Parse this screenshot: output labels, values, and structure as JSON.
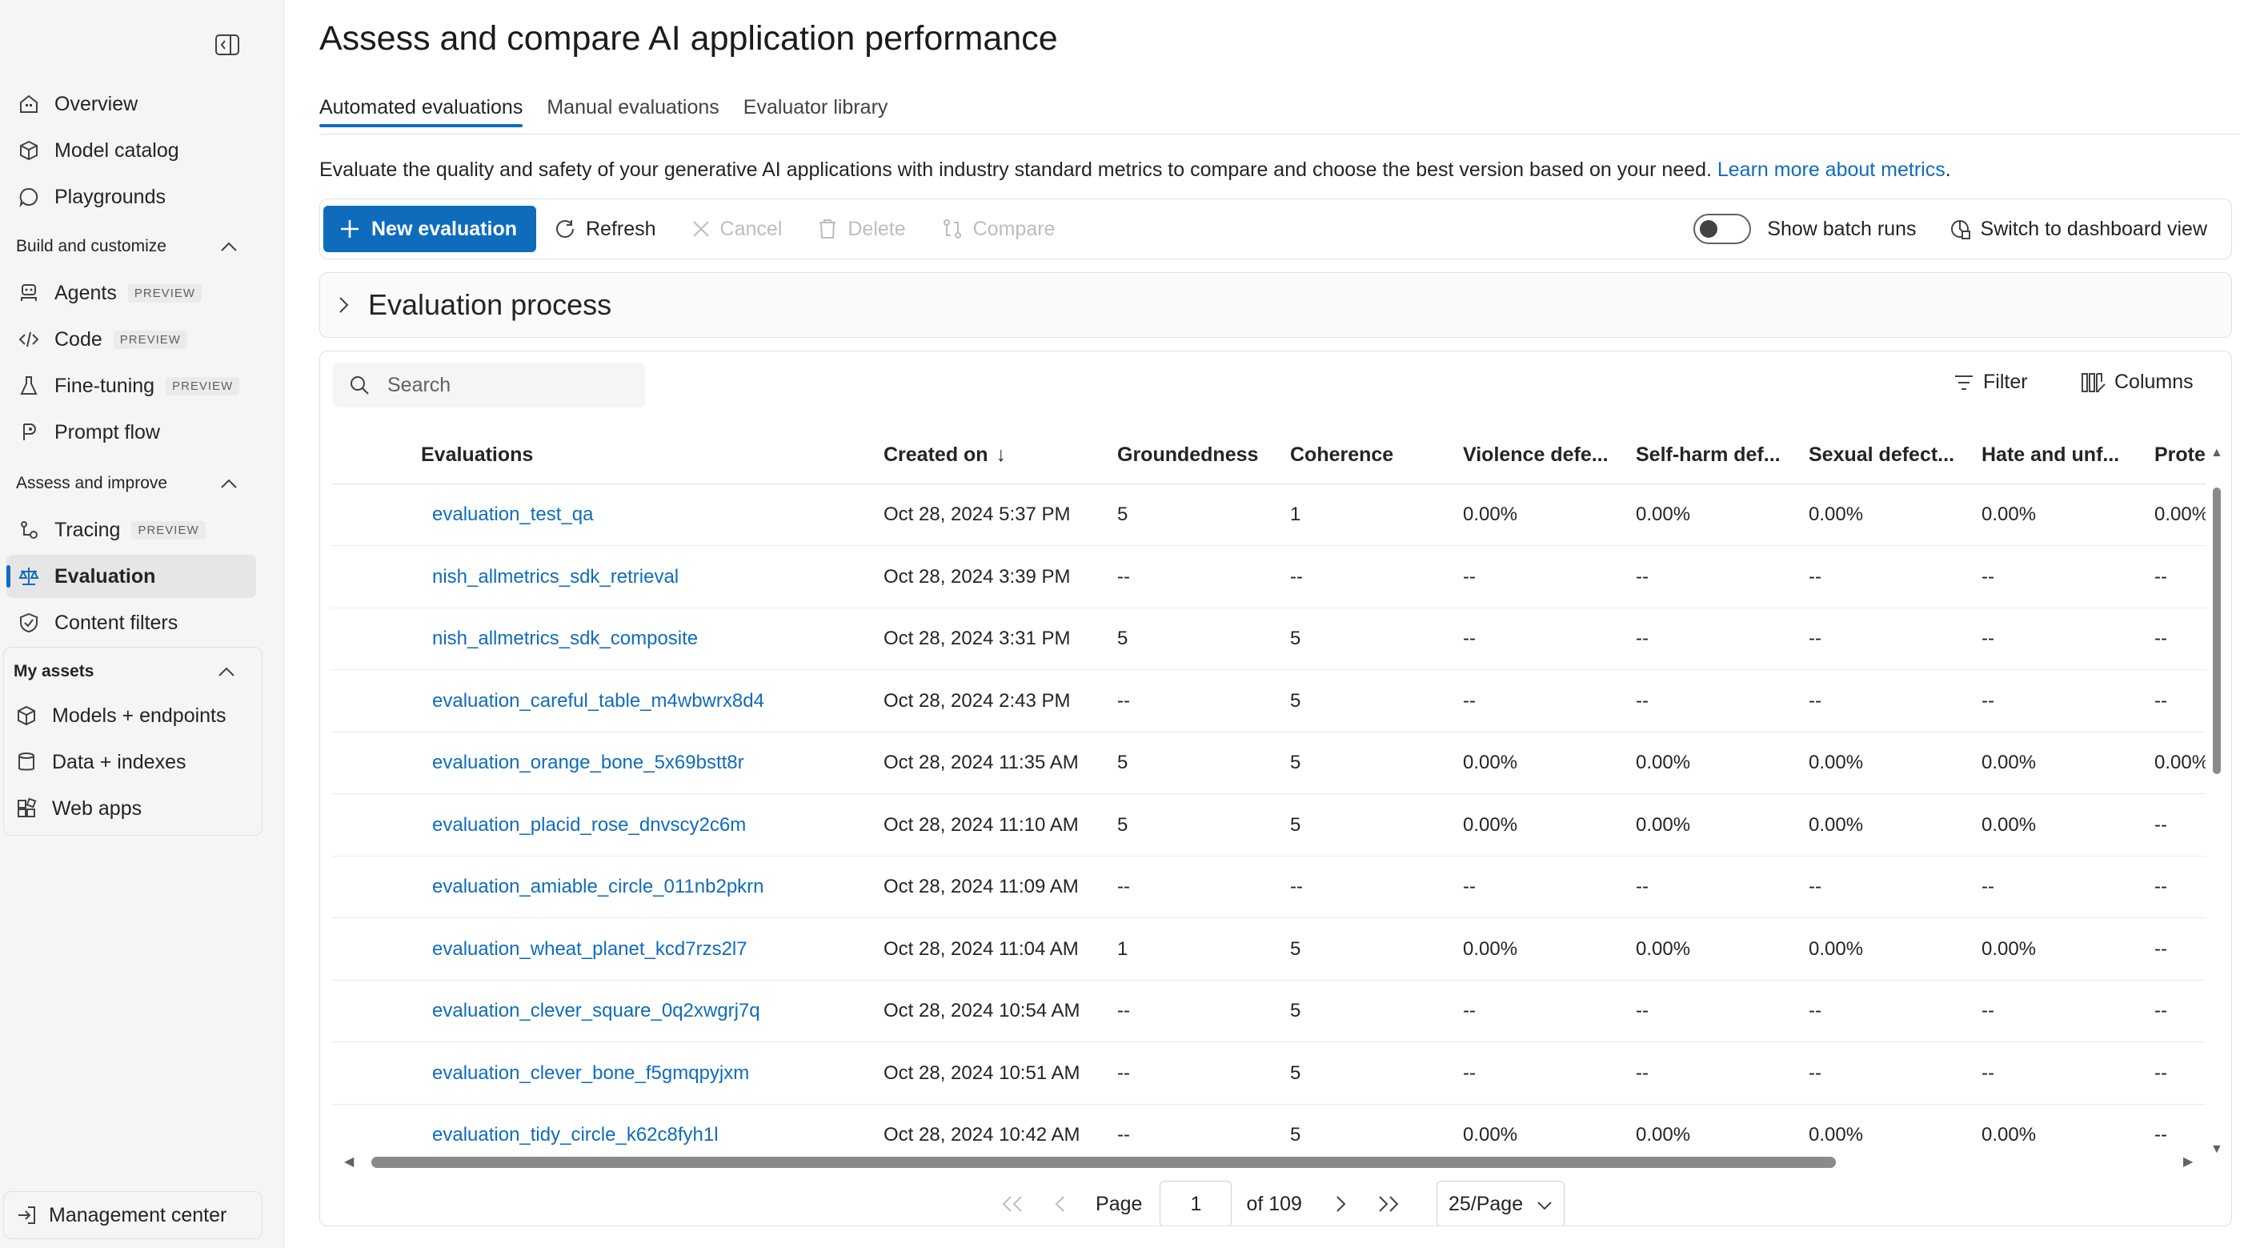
{
  "sidebar": {
    "collapse_icon": "sidebar-collapse-icon",
    "top_items": [
      {
        "label": "Overview",
        "icon": "home-icon"
      },
      {
        "label": "Model catalog",
        "icon": "cube-icon"
      },
      {
        "label": "Playgrounds",
        "icon": "chat-icon"
      }
    ],
    "section_build": "Build and customize",
    "build_items": [
      {
        "label": "Agents",
        "badge": "PREVIEW",
        "icon": "agent-icon"
      },
      {
        "label": "Code",
        "badge": "PREVIEW",
        "icon": "code-icon"
      },
      {
        "label": "Fine-tuning",
        "badge": "PREVIEW",
        "icon": "flask-icon"
      },
      {
        "label": "Prompt flow",
        "icon": "flow-icon"
      }
    ],
    "section_assess": "Assess and improve",
    "assess_items": [
      {
        "label": "Tracing",
        "badge": "PREVIEW",
        "icon": "tracing-icon"
      },
      {
        "label": "Evaluation",
        "icon": "scale-icon",
        "active": true
      },
      {
        "label": "Content filters",
        "icon": "shield-icon"
      }
    ],
    "section_assets": "My assets",
    "asset_items": [
      {
        "label": "Models + endpoints",
        "icon": "cube-icon"
      },
      {
        "label": "Data + indexes",
        "icon": "database-icon"
      },
      {
        "label": "Web apps",
        "icon": "apps-icon"
      }
    ],
    "management": "Management center"
  },
  "main": {
    "title": "Assess and compare AI application performance",
    "tabs": [
      "Automated evaluations",
      "Manual evaluations",
      "Evaluator library"
    ],
    "description": "Evaluate the quality and safety of your generative AI applications with industry standard metrics to compare and choose the best version based on your need.",
    "description_link": "Learn more about metrics",
    "toolbar": {
      "new_evaluation": "New evaluation",
      "refresh": "Refresh",
      "cancel": "Cancel",
      "delete": "Delete",
      "compare": "Compare",
      "show_batch_runs": "Show batch runs",
      "dashboard": "Switch to dashboard view"
    },
    "evaluation_process": "Evaluation process",
    "search_placeholder": "Search",
    "filter": "Filter",
    "columns": "Columns",
    "grid": {
      "headers": [
        "Evaluations",
        "Created on",
        "Groundedness",
        "Coherence",
        "Violence defe...",
        "Self-harm def...",
        "Sexual defect...",
        "Hate and unf...",
        "Protec"
      ],
      "sort_indicator": "↓",
      "rows": [
        [
          "evaluation_test_qa",
          "Oct 28, 2024 5:37 PM",
          "5",
          "1",
          "0.00%",
          "0.00%",
          "0.00%",
          "0.00%",
          "0.00%"
        ],
        [
          "nish_allmetrics_sdk_retrieval",
          "Oct 28, 2024 3:39 PM",
          "--",
          "--",
          "--",
          "--",
          "--",
          "--",
          "--"
        ],
        [
          "nish_allmetrics_sdk_composite",
          "Oct 28, 2024 3:31 PM",
          "5",
          "5",
          "--",
          "--",
          "--",
          "--",
          "--"
        ],
        [
          "evaluation_careful_table_m4wbwrx8d4",
          "Oct 28, 2024 2:43 PM",
          "--",
          "5",
          "--",
          "--",
          "--",
          "--",
          "--"
        ],
        [
          "evaluation_orange_bone_5x69bstt8r",
          "Oct 28, 2024 11:35 AM",
          "5",
          "5",
          "0.00%",
          "0.00%",
          "0.00%",
          "0.00%",
          "0.00%"
        ],
        [
          "evaluation_placid_rose_dnvscy2c6m",
          "Oct 28, 2024 11:10 AM",
          "5",
          "5",
          "0.00%",
          "0.00%",
          "0.00%",
          "0.00%",
          "--"
        ],
        [
          "evaluation_amiable_circle_011nb2pkrn",
          "Oct 28, 2024 11:09 AM",
          "--",
          "--",
          "--",
          "--",
          "--",
          "--",
          "--"
        ],
        [
          "evaluation_wheat_planet_kcd7rzs2l7",
          "Oct 28, 2024 11:04 AM",
          "1",
          "5",
          "0.00%",
          "0.00%",
          "0.00%",
          "0.00%",
          "--"
        ],
        [
          "evaluation_clever_square_0q2xwgrj7q",
          "Oct 28, 2024 10:54 AM",
          "--",
          "5",
          "--",
          "--",
          "--",
          "--",
          "--"
        ],
        [
          "evaluation_clever_bone_f5gmqpyjxm",
          "Oct 28, 2024 10:51 AM",
          "--",
          "5",
          "--",
          "--",
          "--",
          "--",
          "--"
        ],
        [
          "evaluation_tidy_circle_k62c8fyh1l",
          "Oct 28, 2024 10:42 AM",
          "--",
          "5",
          "0.00%",
          "0.00%",
          "0.00%",
          "0.00%",
          "--"
        ]
      ]
    },
    "pager": {
      "page_label": "Page",
      "page_value": "1",
      "of_label": "of 109",
      "per_page": "25/Page"
    }
  },
  "colors": {
    "accent": "#0f6cbd",
    "sidebar_bg": "#f5f5f5"
  }
}
